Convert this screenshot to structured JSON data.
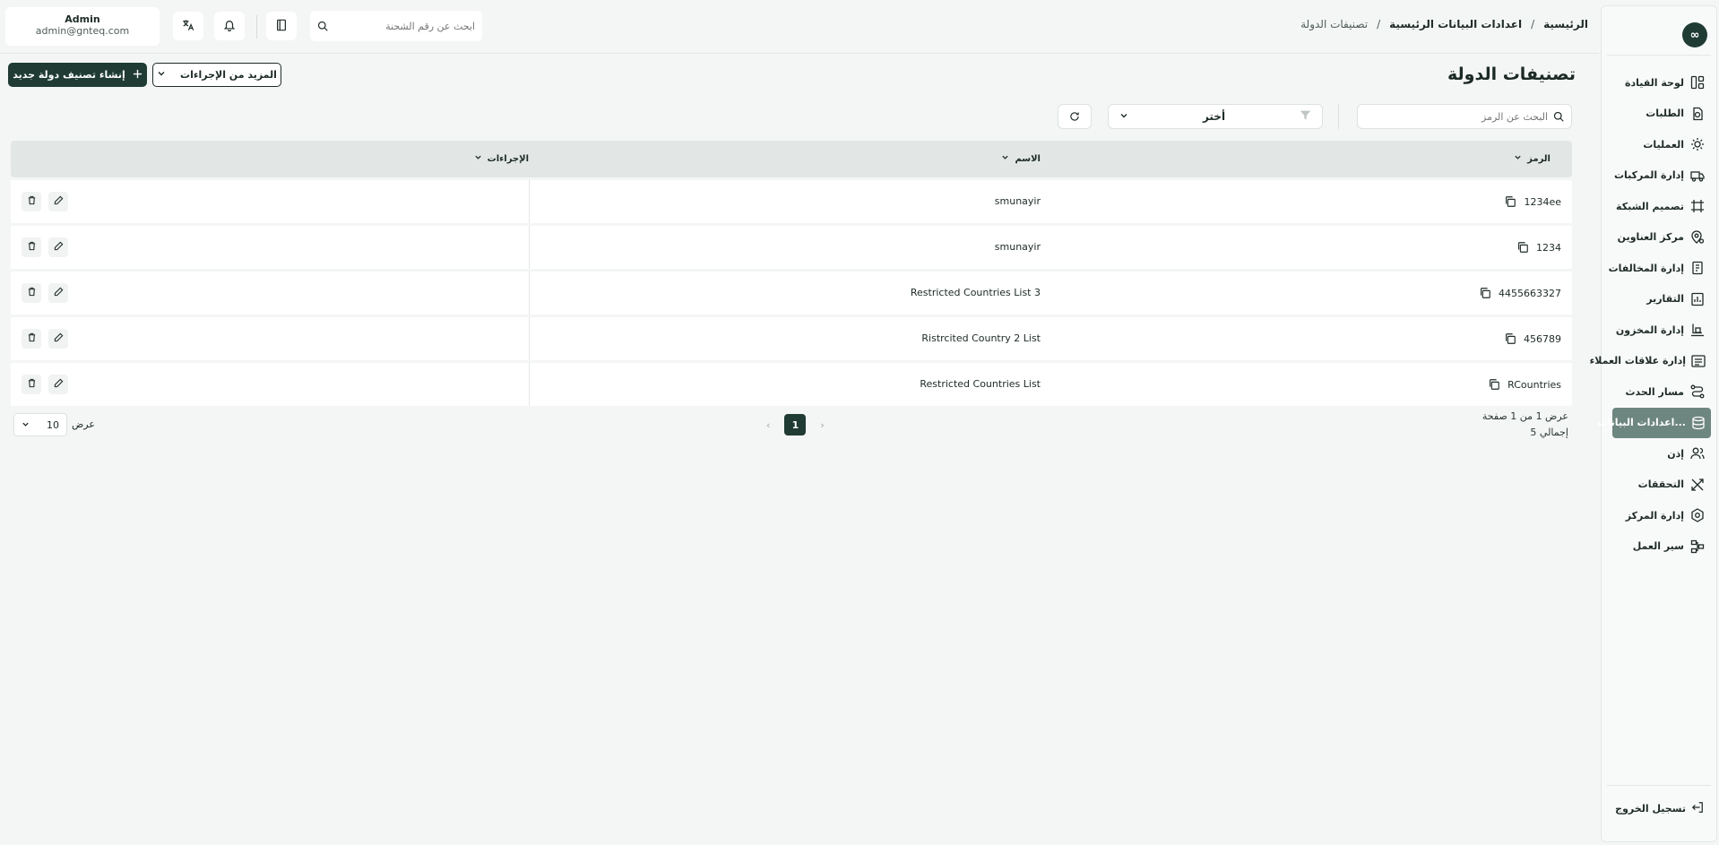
{
  "app": {
    "logo_text": "∞"
  },
  "header": {
    "breadcrumb": [
      {
        "label": "الرئيسية"
      },
      {
        "label": "اعدادات البيانات الرئيسية"
      },
      {
        "label": "تصنيفات الدولة"
      }
    ],
    "breadcrumb_sep": "/",
    "search_placeholder": "ابحث عن رقم الشحنة",
    "user_name": "Admin",
    "user_email": "admin@gnteq.com"
  },
  "sidebar": {
    "items": [
      {
        "label": "لوحة القيادة",
        "icon": "dashboard-icon"
      },
      {
        "label": "الطلبات",
        "icon": "orders-icon"
      },
      {
        "label": "العمليات",
        "icon": "operations-icon"
      },
      {
        "label": "إدارة المركبات",
        "icon": "truck-icon"
      },
      {
        "label": "تصميم الشبكة",
        "icon": "network-icon"
      },
      {
        "label": "مركز العناوين",
        "icon": "address-icon"
      },
      {
        "label": "إدارة المخالفات",
        "icon": "violations-icon"
      },
      {
        "label": "التقارير",
        "icon": "reports-icon"
      },
      {
        "label": "إدارة المخزون",
        "icon": "inventory-icon"
      },
      {
        "label": "إدارة علاقات العملاء",
        "icon": "crm-icon"
      },
      {
        "label": "مسار الحدث",
        "icon": "route-icon"
      },
      {
        "label": "اعدادات البيانات...",
        "icon": "database-icon",
        "active": true
      },
      {
        "label": "إذن",
        "icon": "users-icon"
      },
      {
        "label": "التحققات",
        "icon": "tools-icon"
      },
      {
        "label": "إدارة المركز",
        "icon": "hub-icon"
      },
      {
        "label": "سير العمل",
        "icon": "workflow-icon"
      }
    ],
    "logout_label": "تسجيل الخروج"
  },
  "page": {
    "title": "تصنيفات الدولة",
    "create_button": "إنشاء تصنيف دولة جديد",
    "more_actions_button": "المزيد من الإجراءات",
    "code_search_placeholder": "البحث عن الرمز",
    "filter_select_value": "أختر"
  },
  "table": {
    "columns": {
      "code": "الرمز",
      "name": "الاسم",
      "actions": "الإجراءات"
    },
    "rows": [
      {
        "code": "1234ee",
        "name": "smunayir"
      },
      {
        "code": "1234",
        "name": "smunayir"
      },
      {
        "code": "4455663327",
        "name": "Restricted Countries List 3"
      },
      {
        "code": "456789",
        "name": "Ristrcited Country 2 List"
      },
      {
        "code": "RCountries",
        "name": "Restricted Countries List"
      }
    ]
  },
  "pagination": {
    "show_label": "عرض",
    "page_size": "10",
    "current_page": "1",
    "page_info": "عرض 1 من 1 صفحة",
    "total": "إجمالي 5"
  }
}
